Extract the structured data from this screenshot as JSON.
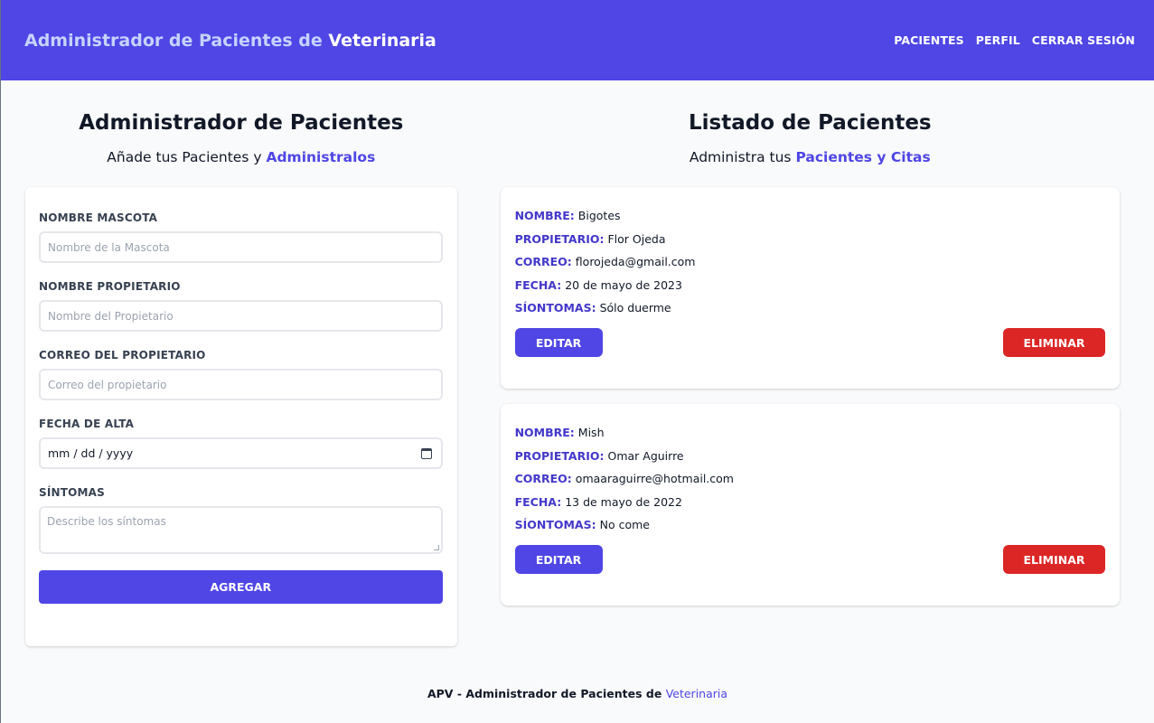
{
  "header": {
    "brand_prefix": "Administrador de Pacientes de",
    "brand_accent": "Veterinaria",
    "nav": [
      {
        "label": "PACIENTES"
      },
      {
        "label": "PERFIL"
      },
      {
        "label": "CERRAR SESIÓN"
      }
    ]
  },
  "form_section": {
    "title": "Administrador de Pacientes",
    "subtitle_prefix": "Añade tus Pacientes y",
    "subtitle_highlight": "Administralos",
    "fields": {
      "pet_name": {
        "label": "NOMBRE MASCOTA",
        "placeholder": "Nombre de la Mascota"
      },
      "owner_name": {
        "label": "NOMBRE PROPIETARIO",
        "placeholder": "Nombre del Propietario"
      },
      "owner_email": {
        "label": "CORREO DEL PROPIETARIO",
        "placeholder": "Correo del propietario"
      },
      "date": {
        "label": "FECHA DE ALTA",
        "value": "mm / dd / yyyy"
      },
      "symptoms": {
        "label": "SÍNTOMAS",
        "placeholder": "Describe los síntomas"
      }
    },
    "submit_label": "AGREGAR"
  },
  "list_section": {
    "title": "Listado de Pacientes",
    "subtitle_prefix": "Administra tus",
    "subtitle_highlight": "Pacientes y Citas",
    "labels": {
      "name": "NOMBRE:",
      "owner": "PROPIETARIO:",
      "email": "CORREO:",
      "date": "FECHA:",
      "symptoms": "SÍONTOMAS:"
    },
    "edit_label": "EDITAR",
    "delete_label": "ELIMINAR",
    "patients": [
      {
        "name": "Bigotes",
        "owner": "Flor Ojeda",
        "email": "florojeda@gmail.com",
        "date": "20 de mayo de 2023",
        "symptoms": "Sólo duerme"
      },
      {
        "name": "Mish",
        "owner": "Omar Aguirre",
        "email": "omaaraguirre@hotmail.com",
        "date": "13 de mayo de 2022",
        "symptoms": "No come"
      }
    ]
  },
  "footer": {
    "prefix": "APV - Administrador de Pacientes de",
    "highlight": "Veterinaria"
  },
  "colors": {
    "primary": "#4f46e5",
    "danger": "#dc2626",
    "background": "#f9fafb"
  }
}
